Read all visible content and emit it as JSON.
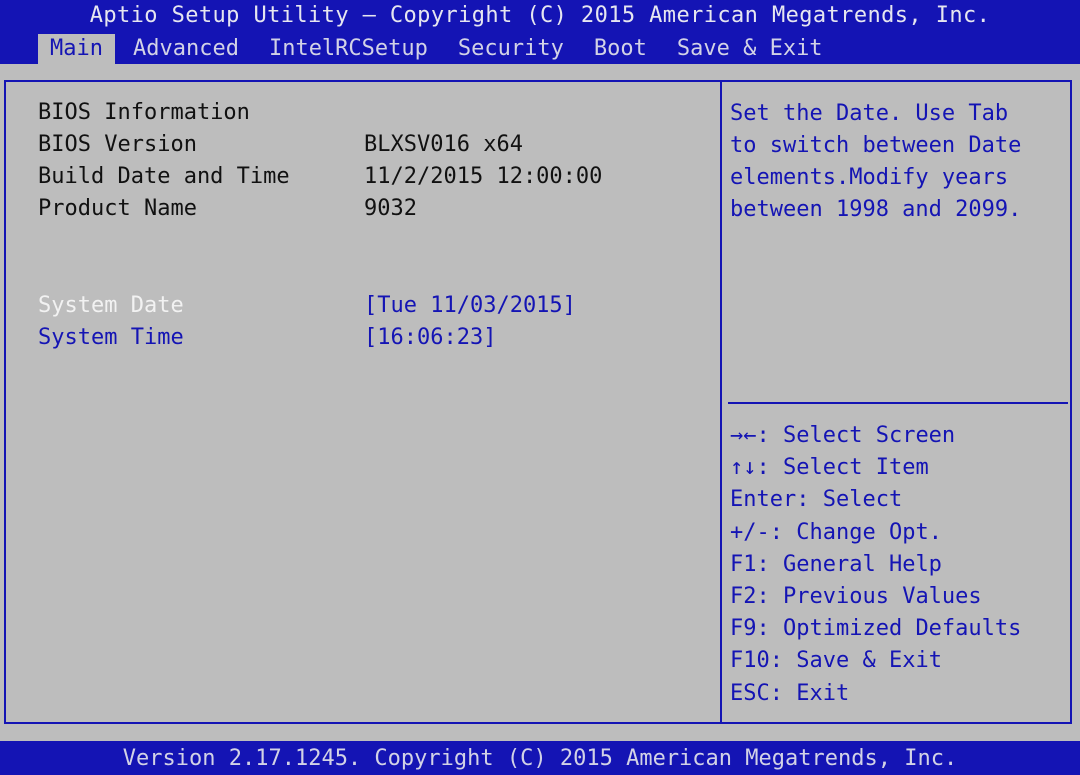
{
  "header": {
    "title": "Aptio Setup Utility – Copyright (C) 2015 American Megatrends, Inc.",
    "tabs": [
      {
        "label": "Main",
        "active": true
      },
      {
        "label": "Advanced",
        "active": false
      },
      {
        "label": "IntelRCSetup",
        "active": false
      },
      {
        "label": "Security",
        "active": false
      },
      {
        "label": "Boot",
        "active": false
      },
      {
        "label": "Save & Exit",
        "active": false
      }
    ]
  },
  "main": {
    "section_heading": "BIOS Information",
    "info": [
      {
        "label": "BIOS Version",
        "value": "BLXSV016 x64"
      },
      {
        "label": "Build Date and Time",
        "value": "11/2/2015 12:00:00"
      },
      {
        "label": "Product Name",
        "value": "9032"
      }
    ],
    "settings": [
      {
        "label": "System Date",
        "value": "[Tue 11/03/2015]",
        "selected": true
      },
      {
        "label": "System Time",
        "value": "[16:06:23]",
        "selected": false
      }
    ]
  },
  "help": {
    "lines": [
      "Set the Date. Use Tab",
      "to switch between Date",
      "elements.Modify years",
      "between 1998 and 2099."
    ]
  },
  "keys": [
    {
      "key": "→←",
      "desc": ": Select Screen"
    },
    {
      "key": "↑↓",
      "desc": ": Select Item"
    },
    {
      "key": "Enter",
      "desc": ": Select"
    },
    {
      "key": "+/-",
      "desc": ": Change Opt."
    },
    {
      "key": "F1",
      "desc": ": General Help"
    },
    {
      "key": "F2",
      "desc": ": Previous Values"
    },
    {
      "key": "F9",
      "desc": ": Optimized Defaults"
    },
    {
      "key": "F10",
      "desc": ": Save & Exit"
    },
    {
      "key": "ESC",
      "desc": ": Exit"
    }
  ],
  "footer": {
    "version": "Version 2.17.1245. Copyright (C) 2015 American Megatrends, Inc."
  },
  "colors": {
    "bar_blue": "#1414b4",
    "panel_gray": "#bdbdbd",
    "highlight_white": "#f2f2f2"
  }
}
